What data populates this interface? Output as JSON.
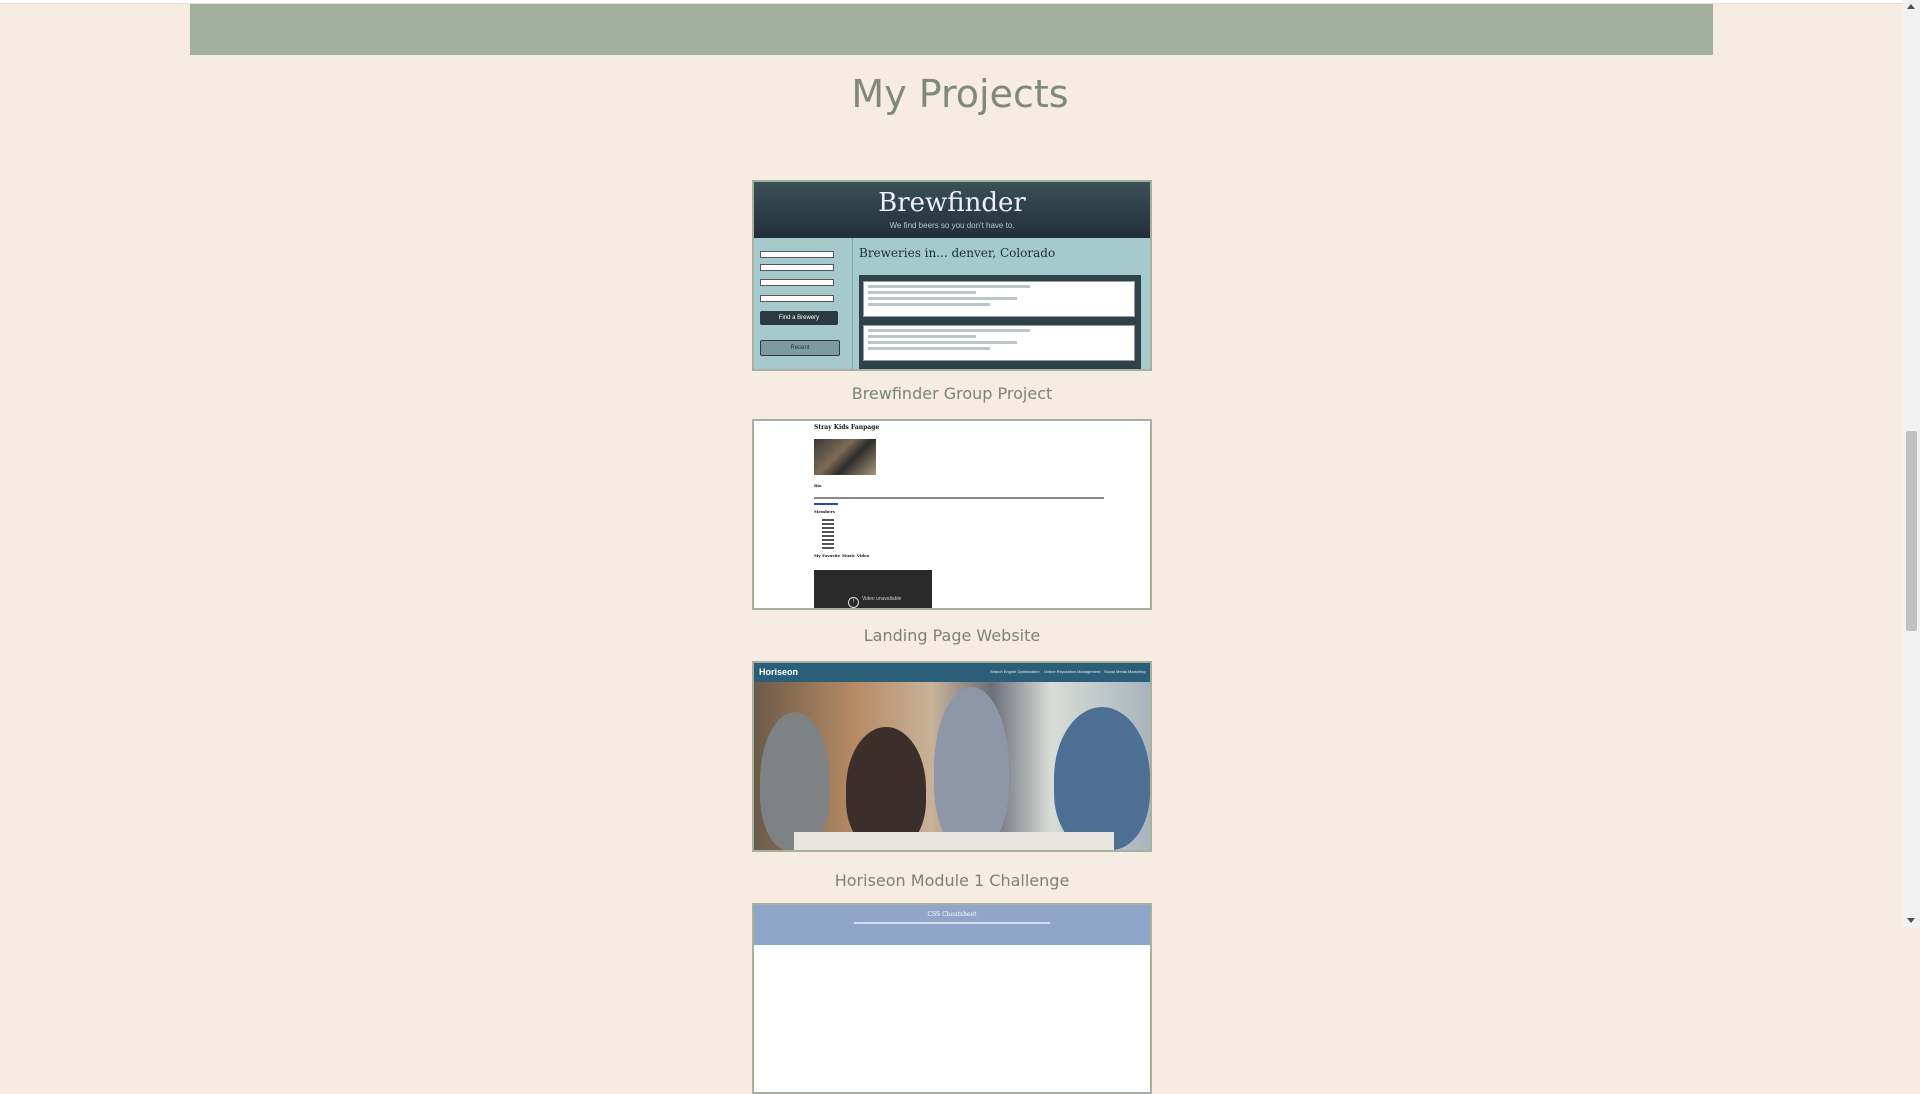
{
  "page": {
    "section_title": "My Projects"
  },
  "projects": [
    {
      "caption": "Brewfinder Group Project",
      "thumb": {
        "title": "Brewfinder",
        "subtitle": "We find beers so you don't have to.",
        "heading": "Breweries in... denver, Colorado",
        "button_primary": "Find a Brewery",
        "button_secondary": "Recent"
      }
    },
    {
      "caption": "Landing Page Website",
      "thumb": {
        "title": "Stray Kids Fanpage",
        "bio_heading": "Bio",
        "members_heading": "Members",
        "video_heading": "My Favorite Music Video",
        "video_text": "Video unavailable"
      }
    },
    {
      "caption": "Horiseon Module 1 Challenge",
      "thumb": {
        "logo": "Horiseon",
        "nav": [
          "Search Engine Optimization",
          "Online Reputation Management",
          "Social Media Marketing"
        ]
      }
    },
    {
      "caption": "",
      "thumb": {
        "title": "CSS Cheatsheet"
      }
    }
  ],
  "colors": {
    "background": "#f6ece2",
    "banner": "#a3b09e",
    "title": "#7f8a79",
    "caption": "#7a8476",
    "border": "#a5b09e"
  }
}
